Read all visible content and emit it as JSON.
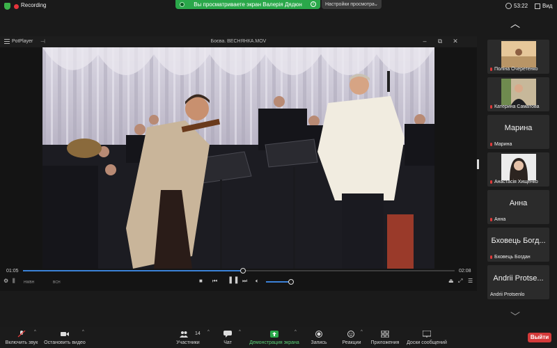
{
  "topbar": {
    "recording_label": "Recording",
    "share_banner": "Вы просматриваете экран Валерія Дядюн",
    "view_options_label": "Настройки просмотра",
    "clock": "53:22",
    "view_label": "Вид",
    "colors": {
      "share_banner": "#2aa84a",
      "recording_dot": "#e5343b"
    }
  },
  "player": {
    "app_name": "PotPlayer",
    "file_name": "Боєва. ВЕСНЯНКА.MOV",
    "time_elapsed": "01:05",
    "time_total": "02:08",
    "progress_fraction": 0.51,
    "volume_fraction": 0.95,
    "small_labels": {
      "left": "HWBH",
      "mid": "BCH"
    },
    "accent": "#3b82d8"
  },
  "participants": [
    {
      "name": "Поліна Очеретенко",
      "has_photo": true,
      "photo": "landscape",
      "muted": true
    },
    {
      "name": "Катерина Саматова",
      "has_photo": true,
      "photo": "portrait-dark",
      "muted": true
    },
    {
      "name": "Марина",
      "big_name": "Марина",
      "has_photo": false,
      "muted": true
    },
    {
      "name": "Анастасія Хищенко",
      "has_photo": true,
      "photo": "portrait-light",
      "muted": true
    },
    {
      "name": "Анна",
      "big_name": "Анна",
      "has_photo": false,
      "muted": true
    },
    {
      "name": "Бховець Богдан",
      "big_name": "Бховець Богд...",
      "has_photo": false,
      "muted": true
    },
    {
      "name": "Andrii Protsenlo",
      "big_name": "Andrii Protse...",
      "has_photo": false,
      "muted": false
    }
  ],
  "toolbar": {
    "unmute_label": "Включить звук",
    "video_label": "Остановить видео",
    "participants_label": "Участники",
    "participants_count": "14",
    "chat_label": "Чат",
    "share_label": "Демонстрация экрана",
    "record_label": "Запись",
    "reactions_label": "Реакции",
    "apps_label": "Приложения",
    "whiteboard_label": "Доски сообщений",
    "leave_label": "Выйти",
    "colors": {
      "share": "#2aa84a",
      "leave": "#d43a3a"
    }
  }
}
